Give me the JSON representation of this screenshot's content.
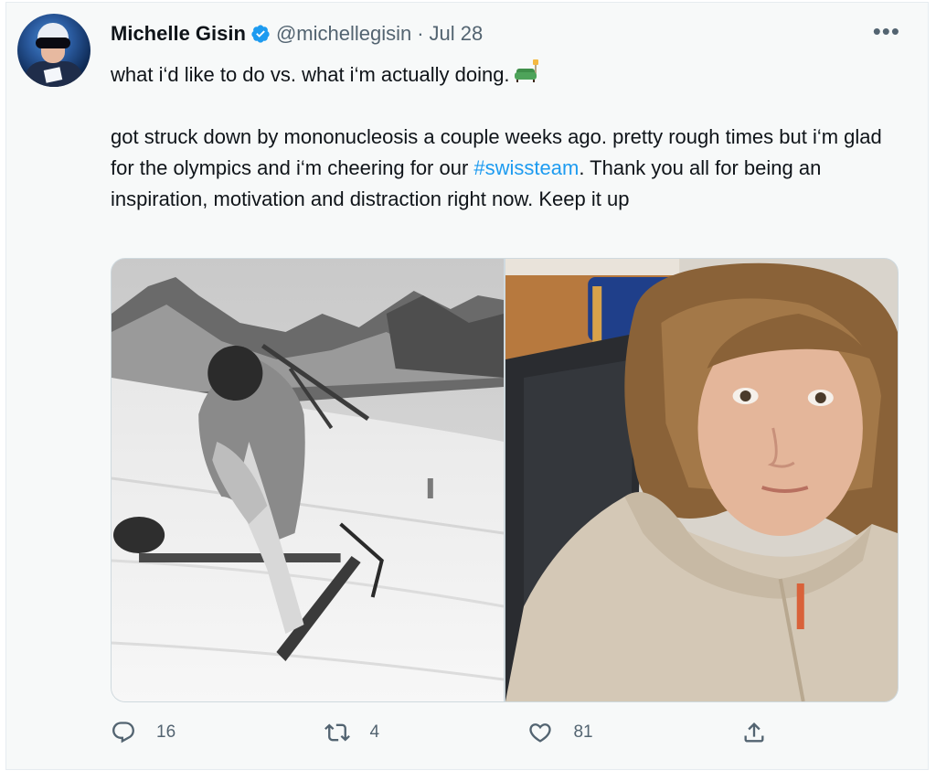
{
  "author": {
    "name": "Michelle Gisin",
    "handle": "@michellegisin",
    "separator": "·",
    "date": "Jul 28",
    "verified": true,
    "avatar_icon": "avatar-skier-photo"
  },
  "more_icon": "more-icon",
  "more_label": "•••",
  "body": {
    "line1": "what i‘d like to do vs. what i‘m actually doing.",
    "line1_emoji_icon": "couch-and-lamp-icon",
    "para2_before": "got struck down by mononucleosis a couple weeks ago. pretty rough times but i‘m glad for the olympics and i‘m cheering for our ",
    "hashtag": "#swissteam",
    "para2_after": ". Thank you all for being an inspiration, motivation and distraction right now. Keep it up"
  },
  "media": [
    {
      "description_icon": "photo-skiing-slalom"
    },
    {
      "description_icon": "photo-selfie-on-couch"
    }
  ],
  "actions": {
    "reply": {
      "icon": "reply-icon",
      "count": "16"
    },
    "retweet": {
      "icon": "retweet-icon",
      "count": "4"
    },
    "like": {
      "icon": "heart-icon",
      "count": "81"
    },
    "share": {
      "icon": "share-icon"
    }
  },
  "colors": {
    "accent": "#1d9bf0",
    "secondary_text": "#536471",
    "card_background": "#f7f9f9"
  }
}
